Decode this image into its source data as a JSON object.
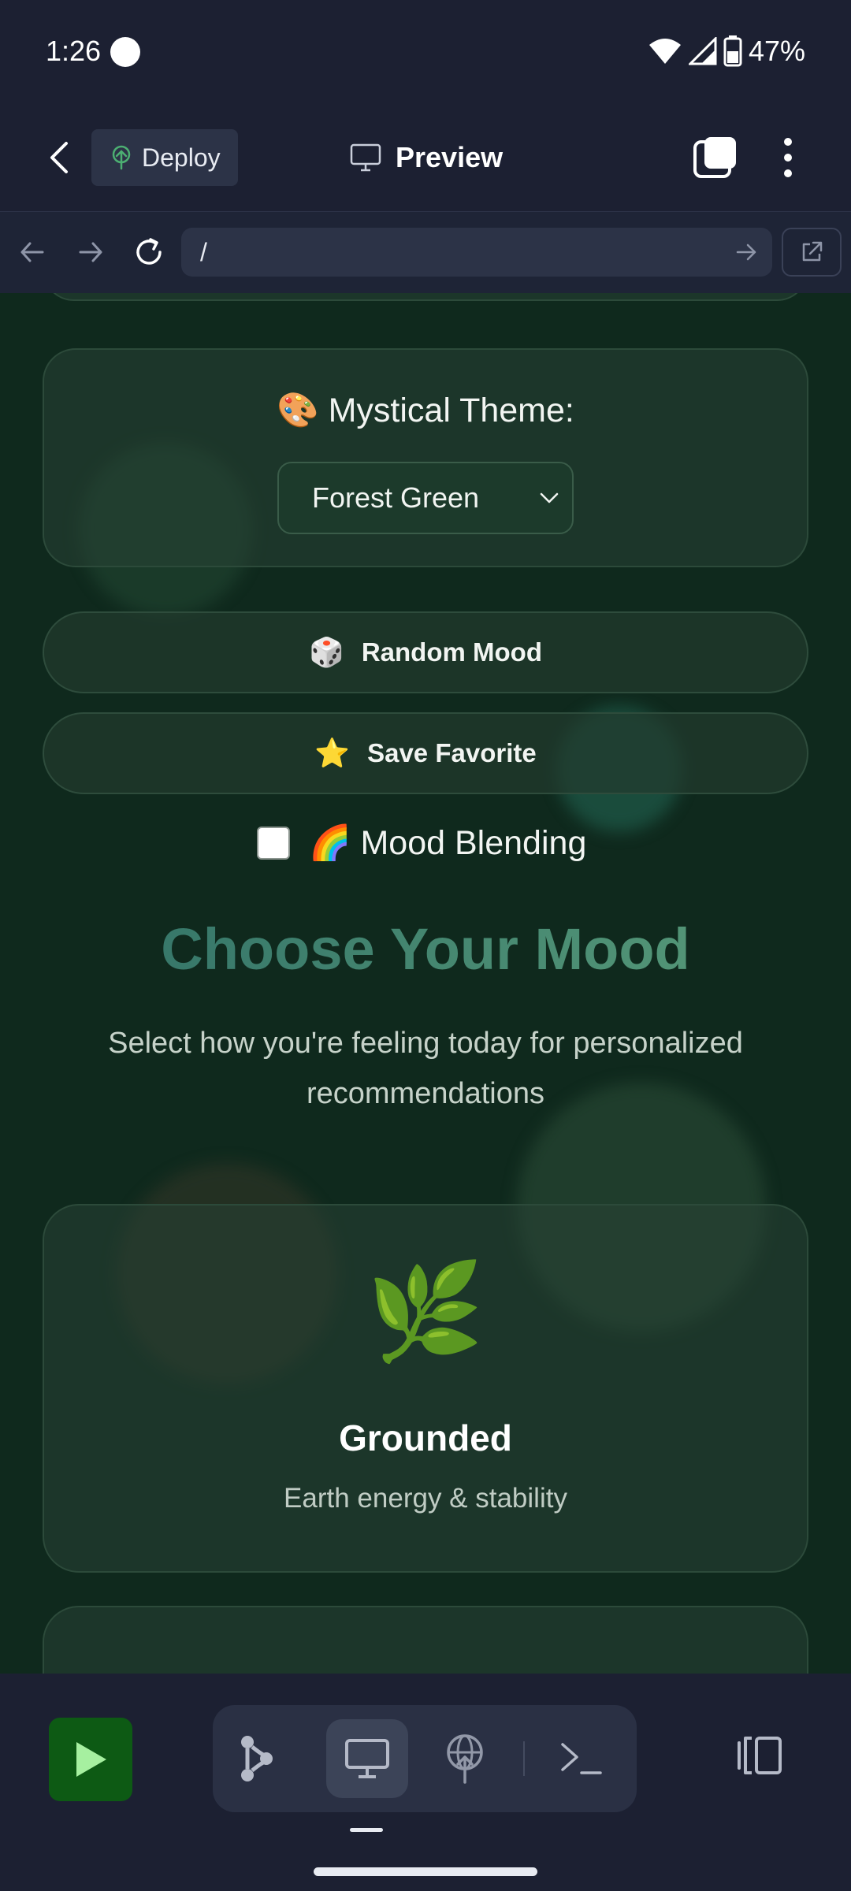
{
  "status_bar": {
    "time": "1:26",
    "battery": "47%",
    "icons": [
      "dot-icon",
      "wifi-icon",
      "signal-icon",
      "battery-icon"
    ]
  },
  "app_bar": {
    "deploy_label": "Deploy",
    "preview_label": "Preview",
    "icons": [
      "back-arrow-icon",
      "deploy-icon",
      "monitor-icon",
      "tabs-icon",
      "more-vert-icon"
    ]
  },
  "browser": {
    "url": "/",
    "icons": [
      "nav-back-icon",
      "nav-forward-icon",
      "reload-icon",
      "go-arrow-icon",
      "external-link-icon"
    ]
  },
  "page": {
    "theme_label": "🎨 Mystical Theme:",
    "theme_selected": "Forest Green",
    "random_mood_label": "Random Mood",
    "random_mood_emoji": "🎲",
    "save_favorite_label": "Save Favorite",
    "save_favorite_emoji": "⭐",
    "blending_label": "🌈 Mood Blending",
    "blending_checked": false,
    "heading": "Choose Your Mood",
    "subheading": "Select how you're feeling today for personalized recommendations",
    "mood_card": {
      "emoji": "🌿",
      "name": "Grounded",
      "description": "Earth energy & stability"
    }
  },
  "bottom_bar": {
    "active_tool": "preview",
    "icons": [
      "play-icon",
      "workflow-icon",
      "preview-monitor-icon",
      "deploy-globe-icon",
      "terminal-icon",
      "panel-icon"
    ]
  },
  "colors": {
    "page_bg": "#0f291d",
    "chrome_bg": "#1c2032",
    "run_button": "#0d5a14",
    "heading_gradient_start": "#2f6f66",
    "heading_gradient_end": "#5a9d7a"
  }
}
